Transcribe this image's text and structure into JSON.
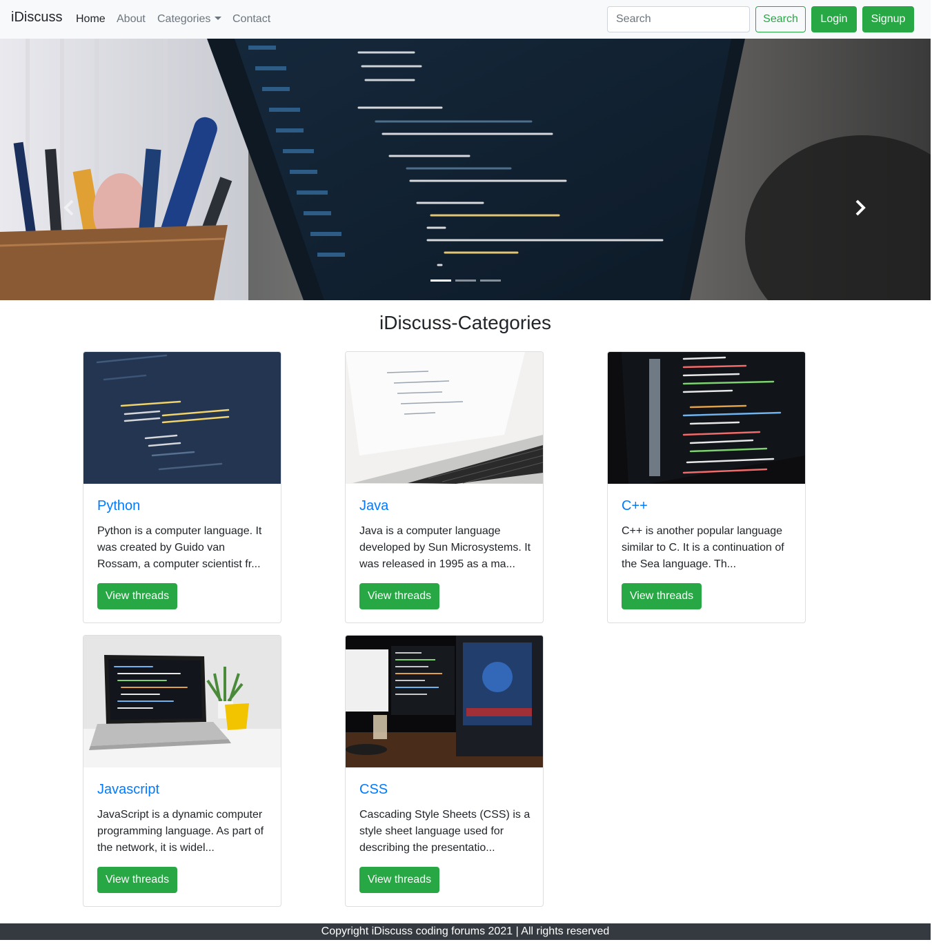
{
  "navbar": {
    "brand": "iDiscuss",
    "links": [
      {
        "label": "Home"
      },
      {
        "label": "About"
      },
      {
        "label": "Categories"
      },
      {
        "label": "Contact"
      }
    ],
    "search_placeholder": "Search",
    "search_button": "Search",
    "login_button": "Login",
    "signup_button": "Signup"
  },
  "carousel": {
    "slide_count": 3,
    "active_slide": 1
  },
  "categories": {
    "heading": "iDiscuss-Categories",
    "items": [
      {
        "title": "Python",
        "description": "Python is a computer language. It was created by Guido van Rossam, a computer scientist fr...",
        "button": "View threads"
      },
      {
        "title": "Java",
        "description": "Java is a computer language developed by Sun Microsystems. It was released in 1995 as a ma...",
        "button": "View threads"
      },
      {
        "title": "C++",
        "description": "C++ is another popular language similar to C. It is a continuation of the Sea language. Th...",
        "button": "View threads"
      },
      {
        "title": "Javascript",
        "description": "JavaScript is a dynamic computer programming language. As part of the network, it is widel...",
        "button": "View threads"
      },
      {
        "title": "CSS",
        "description": "Cascading Style Sheets (CSS) is a style sheet language used for describing the presentatio...",
        "button": "View threads"
      }
    ]
  },
  "footer": {
    "text": "Copyright iDiscuss coding forums 2021 | All rights reserved"
  },
  "colors": {
    "primary_link": "#007bff",
    "success": "#28a745",
    "navbar_bg": "#f8f9fa",
    "footer_bg": "#343a40"
  }
}
